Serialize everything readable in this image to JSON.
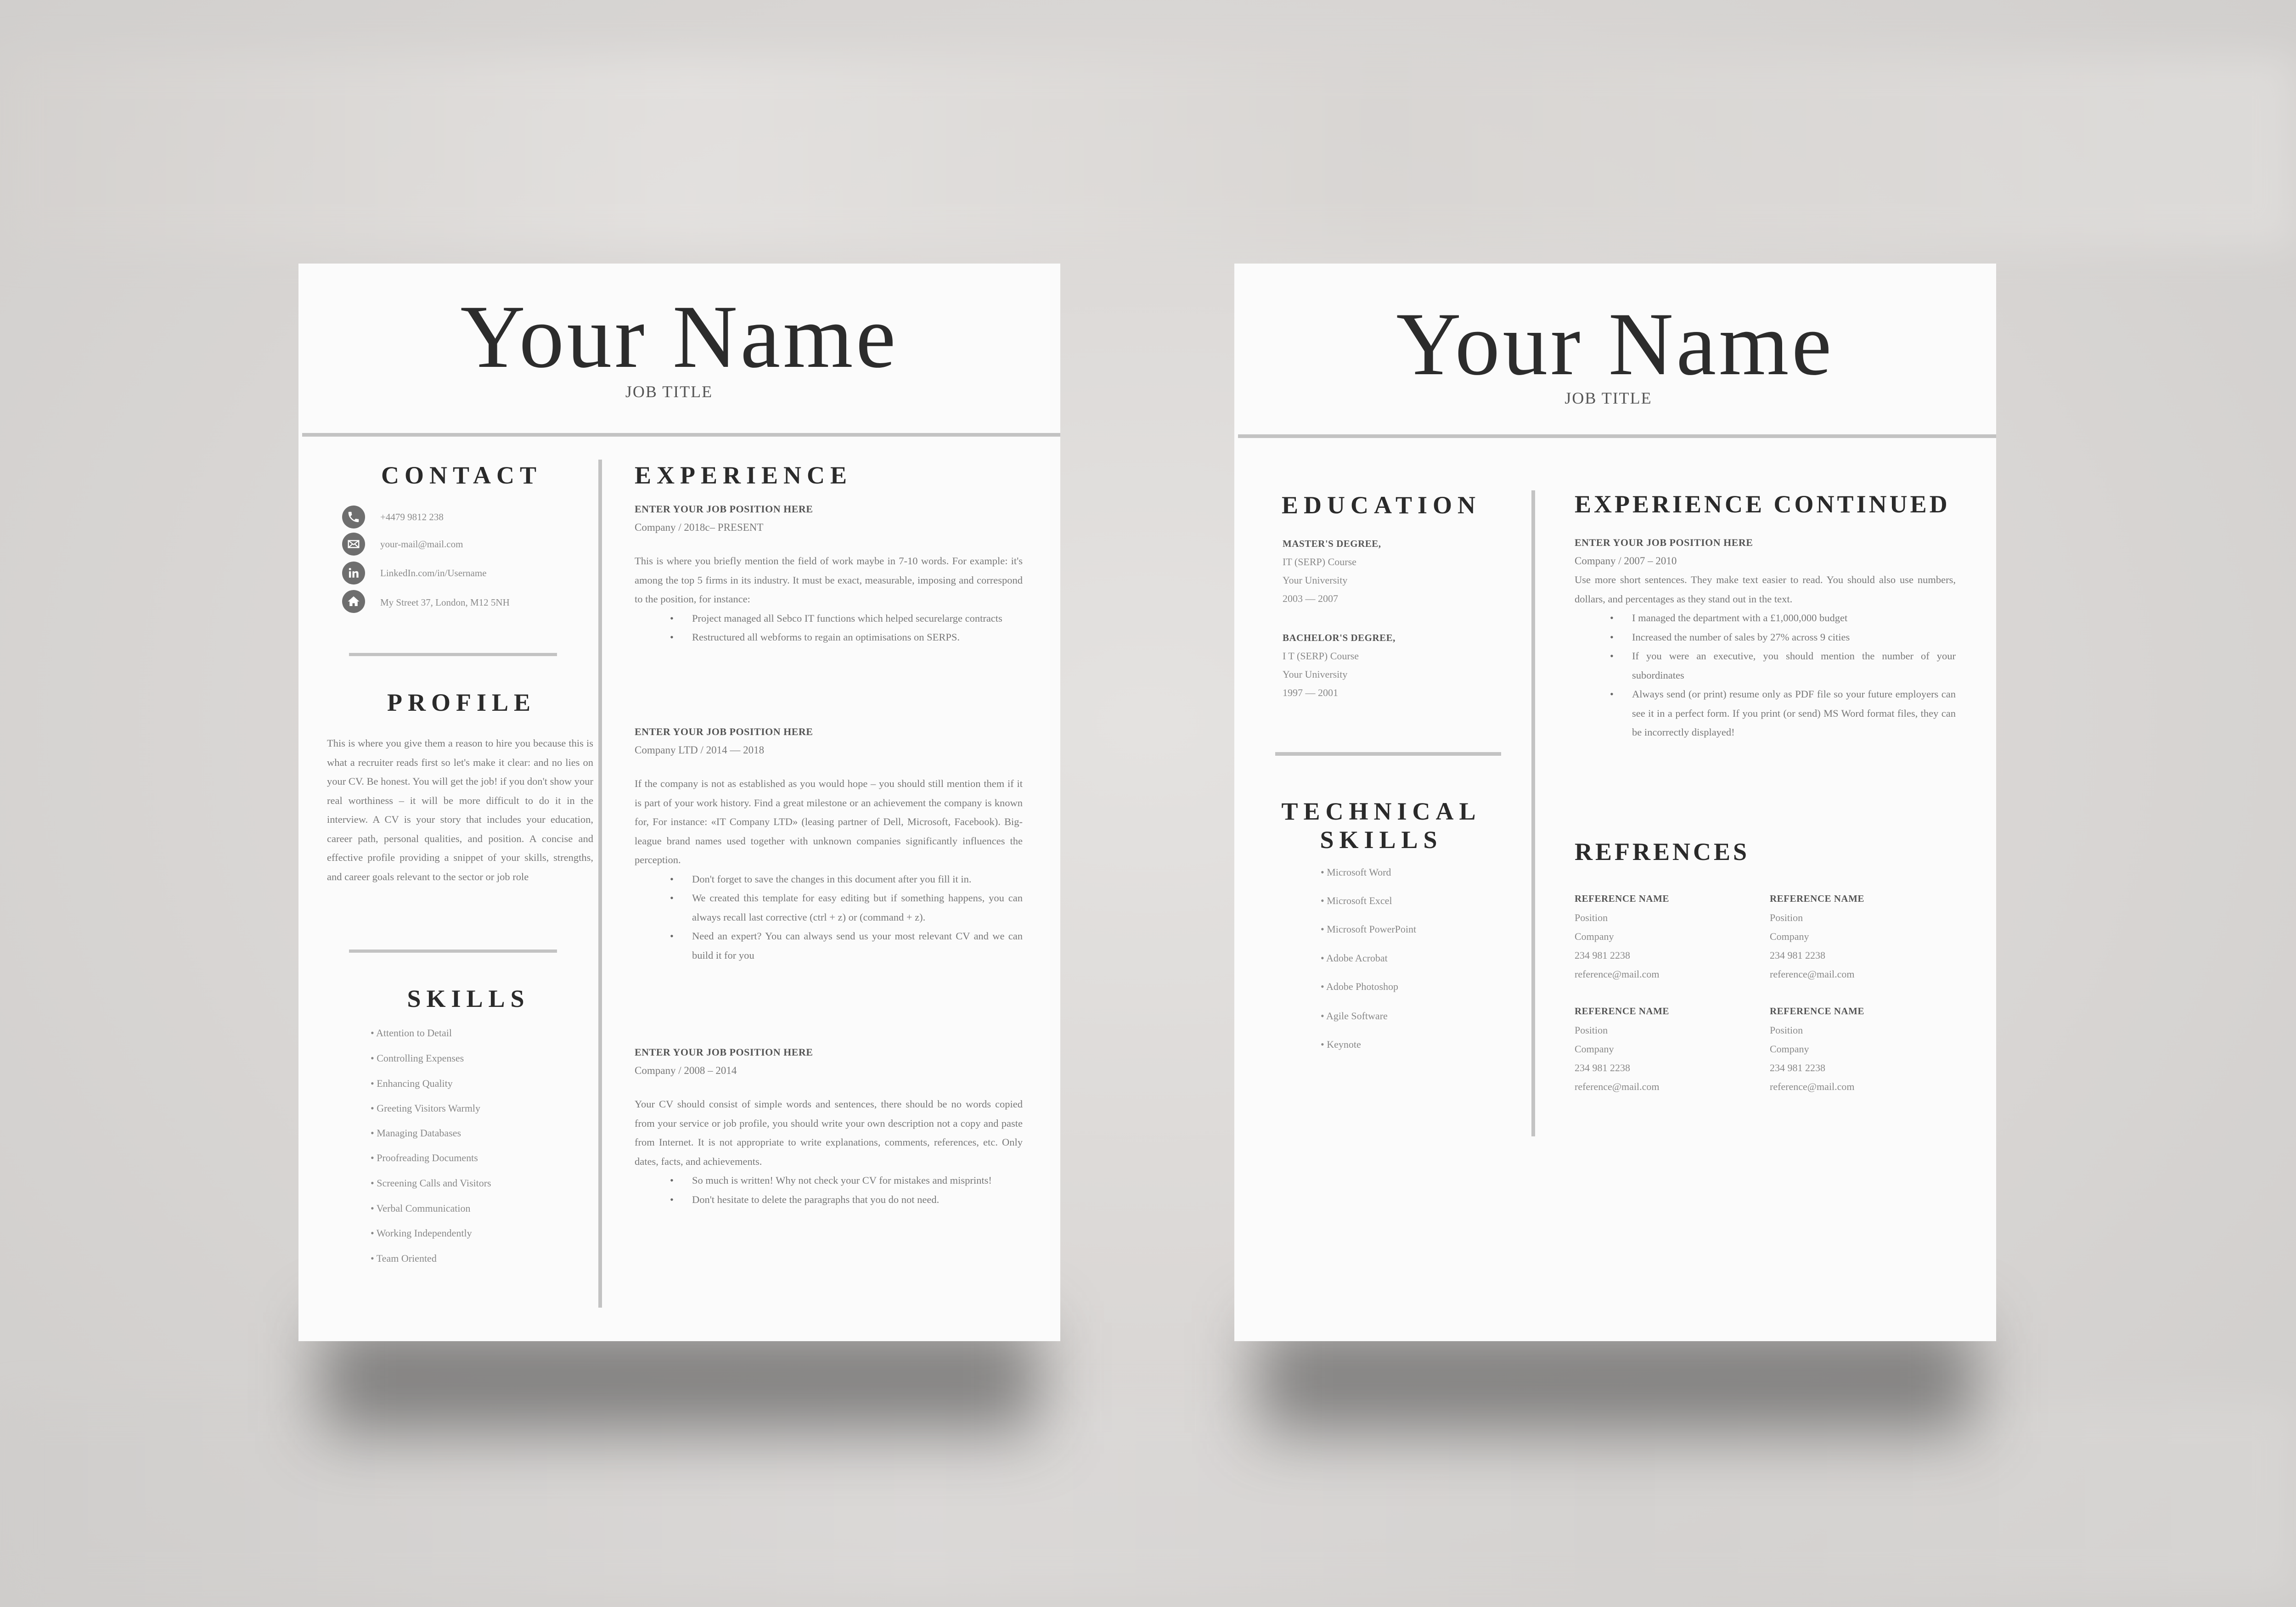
{
  "colors": {
    "page": "#fbfbfb",
    "rule": "#c3c3c3",
    "heading": "#2a2a2a",
    "body_text": "#777777",
    "icon_fill": "#6e6e6e",
    "background": "#dbd8d6"
  },
  "page1": {
    "header": {
      "name": "Your Name",
      "job_title": "JOB TITLE"
    },
    "contact": {
      "title": "CONTACT",
      "items": [
        {
          "icon": "phone-icon",
          "text": "+4479 9812 238"
        },
        {
          "icon": "mail-icon",
          "text": "your-mail@mail.com"
        },
        {
          "icon": "linkedin-icon",
          "text": "LinkedIn.com/in/Username"
        },
        {
          "icon": "home-icon",
          "text": "My Street 37, London, M12 5NH"
        }
      ]
    },
    "profile": {
      "title": "PROFILE",
      "text": "This is where you give them a reason to hire you because this is what a recruiter reads first so let's make it clear: and no lies on your CV. Be honest. You will get the job! if you don't show your real worthiness – it will be more difficult to do it in the interview. A CV is your story that includes your education, career path, personal qualities, and position. A concise and effective profile providing a snippet of your skills, strengths, and career goals relevant to the sector or job role"
    },
    "skills": {
      "title": "SKILLS",
      "items": [
        "• Attention to Detail",
        "• Controlling Expenses",
        "• Enhancing Quality",
        "• Greeting Visitors Warmly",
        "• Managing Databases",
        "• Proofreading Documents",
        "• Screening Calls and Visitors",
        "• Verbal Communication",
        "• Working Independently",
        "• Team Oriented"
      ]
    },
    "experience": {
      "title": "EXPERIENCE",
      "jobs": [
        {
          "position": "ENTER YOUR JOB POSITION HERE",
          "meta": "Company / 2018c– PRESENT",
          "description": "This is where you briefly mention the field of work maybe in 7-10 words. For example: it's among the top 5 firms in its industry. It must be exact, measurable, imposing and correspond to the position, for instance:",
          "bullets": [
            "Project managed all Sebco IT functions which helped securelarge contracts",
            "Restructured all webforms to regain an optimisations on SERPS."
          ]
        },
        {
          "position": "ENTER YOUR JOB POSITION HERE",
          "meta": "Company LTD / 2014 — 2018",
          "description": "If the company is not as established as you would hope – you should still mention them if it is part of your work history. Find a great milestone or an achievement the company is known for, For instance: «IT Company LTD» (leasing partner of Dell, Microsoft, Facebook). Big-league brand names used together with unknown companies significantly influences the perception.",
          "bullets": [
            "Don't forget to save the changes in this document after you fill it in.",
            "We created this template for easy editing but if something happens, you can always recall last corrective (ctrl + z) or (command + z).",
            "Need an expert? You can always send us your most relevant CV and we can build it for you"
          ]
        },
        {
          "position": "ENTER YOUR JOB POSITION HERE",
          "meta": "Company / 2008 – 2014",
          "description": "Your CV should consist of simple words and sentences, there should be no words copied from your service or job profile, you should write your own description not a copy and paste from Internet. It is not appropriate to write explanations, comments, references, etc. Only dates, facts, and achievements.",
          "bullets": [
            "So much is written! Why not check your CV for mistakes and misprints!",
            "Don't hesitate to delete the paragraphs that you do not need."
          ]
        }
      ]
    }
  },
  "page2": {
    "header": {
      "name": "Your Name",
      "job_title": "JOB TITLE"
    },
    "education": {
      "title": "EDUCATION",
      "items": [
        {
          "degree": "MASTER'S DEGREE,",
          "course": "IT (SERP) Course",
          "school": "Your University",
          "years": "2003 — 2007"
        },
        {
          "degree": "BACHELOR'S DEGREE,",
          "course": "I T (SERP) Course",
          "school": "Your University",
          "years": "1997 — 2001"
        }
      ]
    },
    "technical_skills": {
      "title_line1": "TECHNICAL",
      "title_line2": "SKILLS",
      "items": [
        "• Microsoft Word",
        "• Microsoft Excel",
        "• Microsoft PowerPoint",
        "• Adobe Acrobat",
        "• Adobe Photoshop",
        "• Agile Software",
        "• Keynote"
      ]
    },
    "experience_continued": {
      "title": "EXPERIENCE CONTINUED",
      "position": "ENTER YOUR JOB POSITION HERE",
      "meta": "Company / 2007 – 2010",
      "description": "Use more short sentences. They make text easier to read. You should also use numbers, dollars, and percentages as they stand out in the text.",
      "bullets": [
        "I managed the department with a £1,000,000 budget",
        "Increased the number of sales by 27% across 9 cities",
        "If you were an executive, you should mention the number of your subordinates",
        "Always send (or print) resume only as PDF file so your future employers can see it in a perfect form. If you print (or send) MS Word format files, they can be incorrectly displayed!"
      ]
    },
    "references": {
      "title": "REFRENCES",
      "items": [
        {
          "name": "REFERENCE NAME",
          "position": "Position",
          "company": "Company",
          "phone": "234 981 2238",
          "email": "reference@mail.com"
        },
        {
          "name": "REFERENCE NAME",
          "position": "Position",
          "company": "Company",
          "phone": "234 981 2238",
          "email": "reference@mail.com"
        },
        {
          "name": "REFERENCE NAME",
          "position": "Position",
          "company": "Company",
          "phone": "234 981 2238",
          "email": "reference@mail.com"
        },
        {
          "name": "REFERENCE NAME",
          "position": "Position",
          "company": "Company",
          "phone": "234 981 2238",
          "email": "reference@mail.com"
        }
      ]
    }
  }
}
